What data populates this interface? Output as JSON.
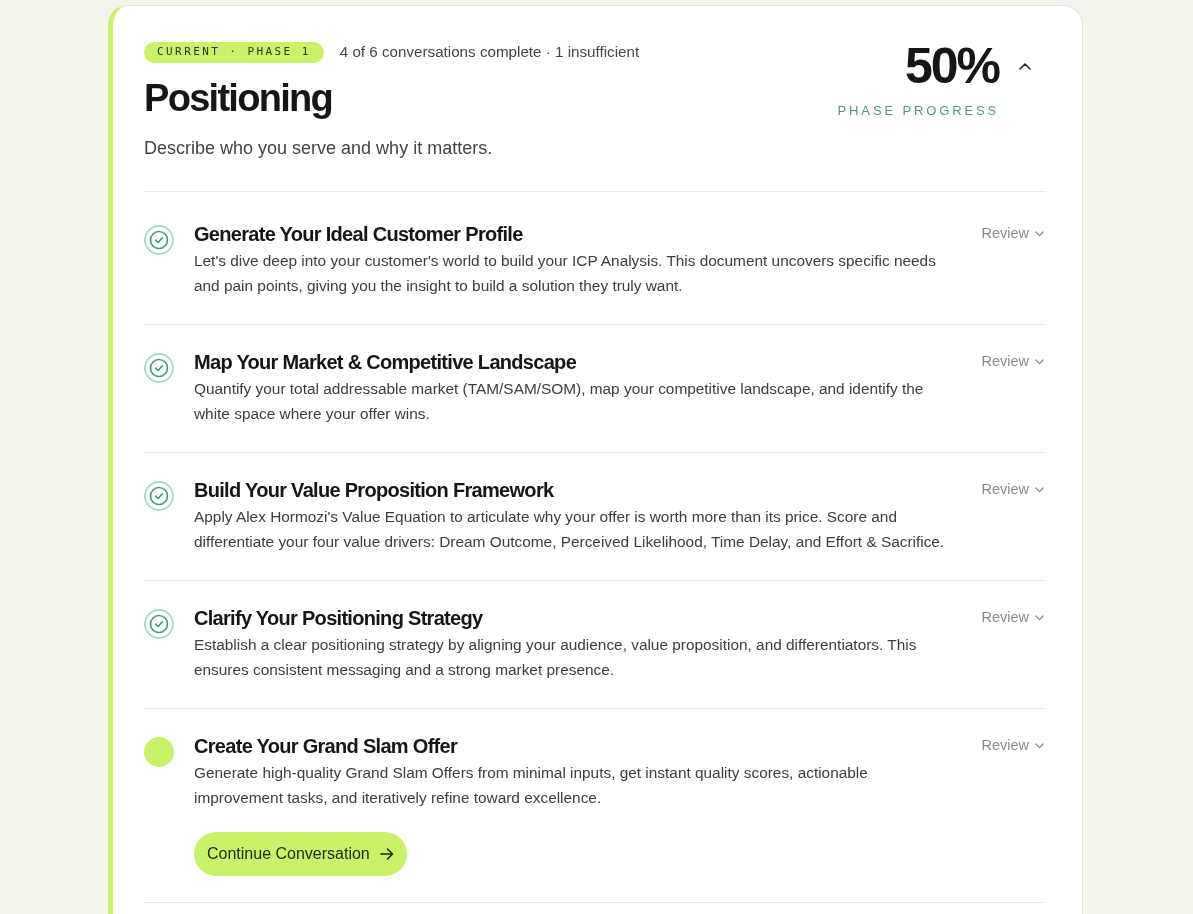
{
  "phase": {
    "badge": "CURRENT · PHASE 1",
    "status": "4 of 6 conversations complete · 1 insufficient",
    "title": "Positioning",
    "description": "Describe who you serve and why it matters.",
    "progress": {
      "value": "50%",
      "label": "PHASE PROGRESS"
    },
    "expanded": true
  },
  "conversations": [
    {
      "kind": "complete",
      "title": "Generate Your Ideal Customer Profile",
      "description": "Let's dive deep into your customer's world to build your ICP Analysis. This document uncovers specific needs and pain points, giving you the insight to build a solution they truly want.",
      "action": "Review"
    },
    {
      "kind": "complete",
      "title": "Map Your Market & Competitive Landscape",
      "description": "Quantify your total addressable market (TAM/SAM/SOM), map your competitive landscape, and identify the white space where your offer wins.",
      "action": "Review"
    },
    {
      "kind": "complete",
      "title": "Build Your Value Proposition Framework",
      "description": "Apply Alex Hormozi's Value Equation to articulate why your offer is worth more than its price. Score and differentiate your four value drivers: Dream Outcome, Perceived Likelihood, Time Delay, and Effort & Sacrifice.",
      "action": "Review"
    },
    {
      "kind": "complete",
      "title": "Clarify Your Positioning Strategy",
      "description": "Establish a clear positioning strategy by aligning your audience, value proposition, and differentiators. This ensures consistent messaging and a strong market presence.",
      "action": "Review"
    },
    {
      "kind": "current",
      "title": "Create Your Grand Slam Offer",
      "description": "Generate high-quality Grand Slam Offers from minimal inputs, get instant quality scores, actionable improvement tasks, and iteratively refine toward excellence.",
      "action": "Review",
      "button": "Continue Conversation"
    }
  ]
}
